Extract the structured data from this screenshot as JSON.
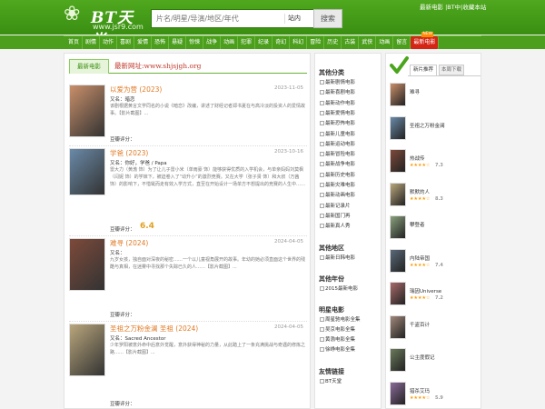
{
  "header": {
    "logo_glyph": "❀",
    "logo_name": "BT天堂",
    "logo_url": "www.jsr9.com",
    "search_placeholder": "片名/明星/导演/地区/年代",
    "search_scope": "站内",
    "search_button": "搜索",
    "top_links": "最新电影 |BT中|收藏本站"
  },
  "nav": [
    {
      "label": "首页"
    },
    {
      "label": "剧情"
    },
    {
      "label": "动作"
    },
    {
      "label": "喜剧"
    },
    {
      "label": "爱情"
    },
    {
      "label": "恐怖"
    },
    {
      "label": "悬疑"
    },
    {
      "label": "惊悚"
    },
    {
      "label": "战争"
    },
    {
      "label": "动画"
    },
    {
      "label": "犯罪"
    },
    {
      "label": "纪录"
    },
    {
      "label": "奇幻"
    },
    {
      "label": "科幻"
    },
    {
      "label": "冒险"
    },
    {
      "label": "历史"
    },
    {
      "label": "古装"
    },
    {
      "label": "武侠"
    },
    {
      "label": "动画"
    },
    {
      "label": "留言"
    },
    {
      "label": "最新电影",
      "badge": "NEW"
    }
  ],
  "main": {
    "tab": "最新电影",
    "new_url": "最新网址:www.shjsjgh.org",
    "items": [
      {
        "title": "以爱为营 (2023)",
        "date": "2023-11-05",
        "line1": "又名：暗恋",
        "desc": "该剧根据黄言文学同名的小说《暗恋》改编，讲述了财经记者郑书夏在与高冷淡的投资人的爱情故事。【影片截图】...",
        "rating": "豆瓣评分：",
        "score": ""
      },
      {
        "title": "学爸 (2023)",
        "date": "2023-10-16",
        "line1": "又名：你好，学爸 / Papa",
        "desc": "雷大力（黄渤 饰）为了让儿子雷小米（单雨豪 饰）能够获得优质的入学机会，与单亲妈妈刘莫枫（闫妮 饰）的学妹下，被迫卷入了“幼升小”的激烈竞赛。又在大学（张子贤 饰）和大叔（万茜 饰）的影响下，不惜铤而走有效入学方式，直至在开始设计一场单方不想提出的竞赛的人生中……",
        "rating": "豆瓣评分：",
        "score": "6.4"
      },
      {
        "title": "难寻 (2024)",
        "date": "2024-04-05",
        "line1": "又名：",
        "desc": "九岁女孩，独自面对深夜的秘密……一个以儿童视角展开的故事。年幼的她必须直面这个世界的残酷与真相，在迷雾中寻找那个失踪已久的人……【影片截图】...",
        "rating": "豆瓣评分：",
        "score": ""
      },
      {
        "title": "圣祖之万粉金澜 圣祖 (2024)",
        "date": "2024-04-05",
        "line1": "又名：Sacred Ancestor",
        "desc": "少年罗阳被意外命中后意外觉醒，意外获得神秘的力量，从此踏上了一条充满挑战与奇遇的修炼之路……【影片截图】...",
        "rating": "豆瓣评分：",
        "score": ""
      }
    ]
  },
  "side": {
    "cat_title": "其他分类",
    "cats": [
      "最新剧情电影",
      "最新喜剧电影",
      "最新动作电影",
      "最新爱情电影",
      "最新恐怖电影",
      "最新儿童电影",
      "最新运动电影",
      "最新冒险电影",
      "最新战争电影",
      "最新历史电影",
      "最新灾难电影",
      "最新动画电影",
      "最新记录片",
      "最新国门再",
      "最新真人秀"
    ],
    "region_title": "其他地区",
    "regions": [
      "最新日韩电影"
    ],
    "year_title": "其他年份",
    "years": [
      "2015最新电影"
    ],
    "star_title": "明星电影",
    "stars": [
      "周星驰电影全集",
      "吴京电影全集",
      "黄渤电影全集",
      "徐峥电影全集"
    ],
    "link_title": "友情链接",
    "links": [
      "BT天堂"
    ]
  },
  "right": {
    "tab_active": "新片推荐",
    "tab_inactive": "本周下载",
    "items": [
      {
        "title": "难寻",
        "stars": "",
        "score": ""
      },
      {
        "title": "圣祖之万粉金澜",
        "stars": "",
        "score": ""
      },
      {
        "title": "热战传",
        "stars": "★★★★☆",
        "score": "7.3"
      },
      {
        "title": "默默的人",
        "stars": "★★★★☆",
        "score": "8.3"
      },
      {
        "title": "攀登者",
        "stars": "",
        "score": ""
      },
      {
        "title": "内陆帝国",
        "stars": "★★★★☆",
        "score": "7.4"
      },
      {
        "title": "瑞因Universe",
        "stars": "★★★★☆",
        "score": "7.2"
      },
      {
        "title": "千盗百计",
        "stars": "",
        "score": ""
      },
      {
        "title": "公主度假记",
        "stars": "",
        "score": ""
      },
      {
        "title": "猎杀艾玛",
        "stars": "★★★★☆",
        "score": "5.9"
      }
    ]
  },
  "colors": {
    "accent": "#3a8f12",
    "title": "#e07a24",
    "score": "#e0a020"
  }
}
